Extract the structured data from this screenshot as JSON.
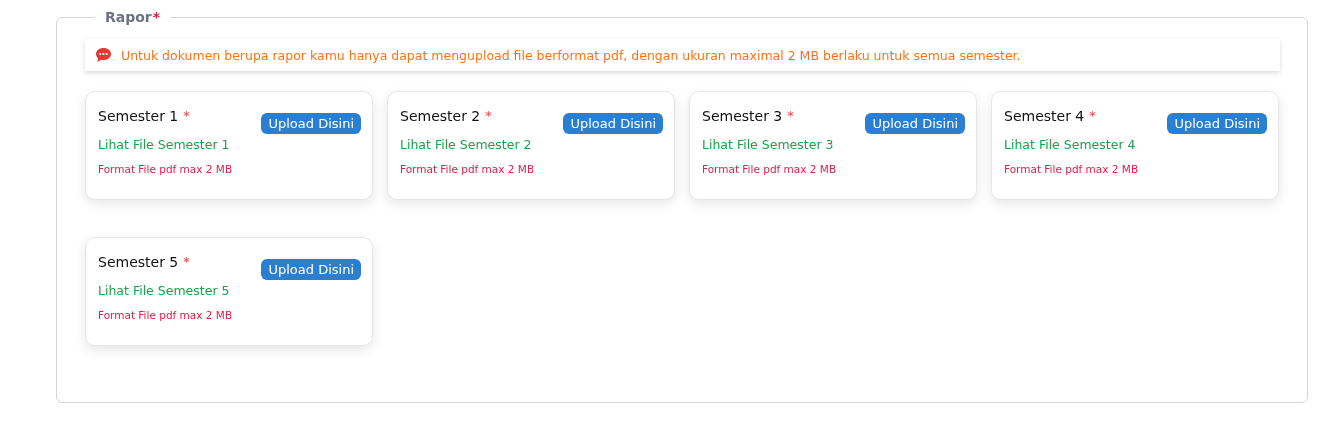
{
  "section": {
    "title": "Rapor",
    "required_mark": "*"
  },
  "notice": {
    "text": "Untuk dokumen berupa rapor kamu hanya dapat mengupload file berformat pdf, dengan ukuran maximal 2 MB berlaku untuk semua semester."
  },
  "cards": [
    {
      "title": "Semester 1",
      "required_mark": "*",
      "button": "Upload Disini",
      "link": "Lihat File Semester 1",
      "hint": "Format File pdf max 2 MB"
    },
    {
      "title": "Semester 2",
      "required_mark": "*",
      "button": "Upload Disini",
      "link": "Lihat File Semester 2",
      "hint": "Format File pdf max 2 MB"
    },
    {
      "title": "Semester 3",
      "required_mark": "*",
      "button": "Upload Disini",
      "link": "Lihat File Semester 3",
      "hint": "Format File pdf max 2 MB"
    },
    {
      "title": "Semester 4",
      "required_mark": "*",
      "button": "Upload Disini",
      "link": "Lihat File Semester 4",
      "hint": "Format File pdf max 2 MB"
    },
    {
      "title": "Semester 5",
      "required_mark": "*",
      "button": "Upload Disini",
      "link": "Lihat File Semester 5",
      "hint": "Format File pdf max 2 MB"
    }
  ]
}
